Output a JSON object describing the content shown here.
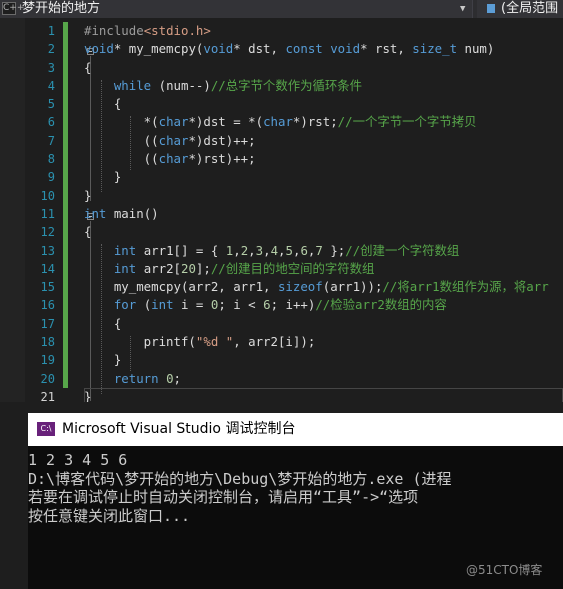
{
  "navbar": {
    "file_icon": "C++",
    "file_title": "梦开始的地方",
    "dropdown_icon": "chevron-down-icon",
    "scope_label": "(全局范围"
  },
  "editor": {
    "line_numbers": [
      "1",
      "2",
      "3",
      "4",
      "5",
      "6",
      "7",
      "8",
      "9",
      "10",
      "11",
      "12",
      "13",
      "14",
      "15",
      "16",
      "17",
      "18",
      "19",
      "20",
      "21"
    ],
    "current_line": "21"
  },
  "console": {
    "icon": "C:\\",
    "title": "Microsoft Visual Studio 调试控制台",
    "lines": [
      "1 2 3 4 5 6",
      "D:\\博客代码\\梦开始的地方\\Debug\\梦开始的地方.exe (进程",
      "若要在调试停止时自动关闭控制台，请启用“工具”->“选项",
      "按任意键关闭此窗口..."
    ]
  },
  "watermark": "@51CTO博客",
  "code_lines": [
    [
      [
        "pp",
        "#include"
      ],
      [
        "str",
        "<stdio.h>"
      ]
    ],
    [
      [
        "kw",
        "void"
      ],
      [
        "t",
        "* my_memcpy("
      ],
      [
        "kw",
        "void"
      ],
      [
        "t",
        "* dst, "
      ],
      [
        "kw",
        "const"
      ],
      [
        "t",
        " "
      ],
      [
        "kw",
        "void"
      ],
      [
        "t",
        "* rst, "
      ],
      [
        "kw",
        "size_t"
      ],
      [
        "t",
        " num)"
      ]
    ],
    [
      [
        "t",
        "{"
      ]
    ],
    [
      [
        "t",
        "    "
      ],
      [
        "kw",
        "while"
      ],
      [
        "t",
        " (num--)"
      ],
      [
        "cm",
        "//总字节个数作为循环条件"
      ]
    ],
    [
      [
        "t",
        "    {"
      ]
    ],
    [
      [
        "t",
        "        *("
      ],
      [
        "kw",
        "char"
      ],
      [
        "t",
        "*)dst = *("
      ],
      [
        "kw",
        "char"
      ],
      [
        "t",
        "*)rst;"
      ],
      [
        "cm",
        "//一个字节一个字节拷贝"
      ]
    ],
    [
      [
        "t",
        "        (("
      ],
      [
        "kw",
        "char"
      ],
      [
        "t",
        "*)dst)++;"
      ]
    ],
    [
      [
        "t",
        "        (("
      ],
      [
        "kw",
        "char"
      ],
      [
        "t",
        "*)rst)++;"
      ]
    ],
    [
      [
        "t",
        "    }"
      ]
    ],
    [
      [
        "t",
        "}"
      ]
    ],
    [
      [
        "kw",
        "int"
      ],
      [
        "t",
        " main()"
      ]
    ],
    [
      [
        "t",
        "{"
      ]
    ],
    [
      [
        "t",
        "    "
      ],
      [
        "kw",
        "int"
      ],
      [
        "t",
        " arr1[] = { "
      ],
      [
        "num",
        "1"
      ],
      [
        "t",
        ","
      ],
      [
        "num",
        "2"
      ],
      [
        "t",
        ","
      ],
      [
        "num",
        "3"
      ],
      [
        "t",
        ","
      ],
      [
        "num",
        "4"
      ],
      [
        "t",
        ","
      ],
      [
        "num",
        "5"
      ],
      [
        "t",
        ","
      ],
      [
        "num",
        "6"
      ],
      [
        "t",
        ","
      ],
      [
        "num",
        "7"
      ],
      [
        "t",
        " };"
      ],
      [
        "cm",
        "//创建一个字符数组"
      ]
    ],
    [
      [
        "t",
        "    "
      ],
      [
        "kw",
        "int"
      ],
      [
        "t",
        " arr2["
      ],
      [
        "num",
        "20"
      ],
      [
        "t",
        "];"
      ],
      [
        "cm",
        "//创建目的地空间的字符数组"
      ]
    ],
    [
      [
        "t",
        "    my_memcpy(arr2, arr1, "
      ],
      [
        "kw",
        "sizeof"
      ],
      [
        "t",
        "(arr1));"
      ],
      [
        "cm",
        "//将arr1数组作为源，将arr"
      ]
    ],
    [
      [
        "t",
        "    "
      ],
      [
        "kw",
        "for"
      ],
      [
        "t",
        " ("
      ],
      [
        "kw",
        "int"
      ],
      [
        "t",
        " i = "
      ],
      [
        "num",
        "0"
      ],
      [
        "t",
        "; i < "
      ],
      [
        "num",
        "6"
      ],
      [
        "t",
        "; i++)"
      ],
      [
        "cm",
        "//检验arr2数组的内容"
      ]
    ],
    [
      [
        "t",
        "    {"
      ]
    ],
    [
      [
        "t",
        "        printf("
      ],
      [
        "str",
        "\"%d \""
      ],
      [
        "t",
        ", arr2[i]);"
      ]
    ],
    [
      [
        "t",
        "    }"
      ]
    ],
    [
      [
        "t",
        "    "
      ],
      [
        "kw",
        "return"
      ],
      [
        "t",
        " "
      ],
      [
        "num",
        "0"
      ],
      [
        "t",
        ";"
      ]
    ],
    [
      [
        "t",
        "}"
      ]
    ]
  ]
}
